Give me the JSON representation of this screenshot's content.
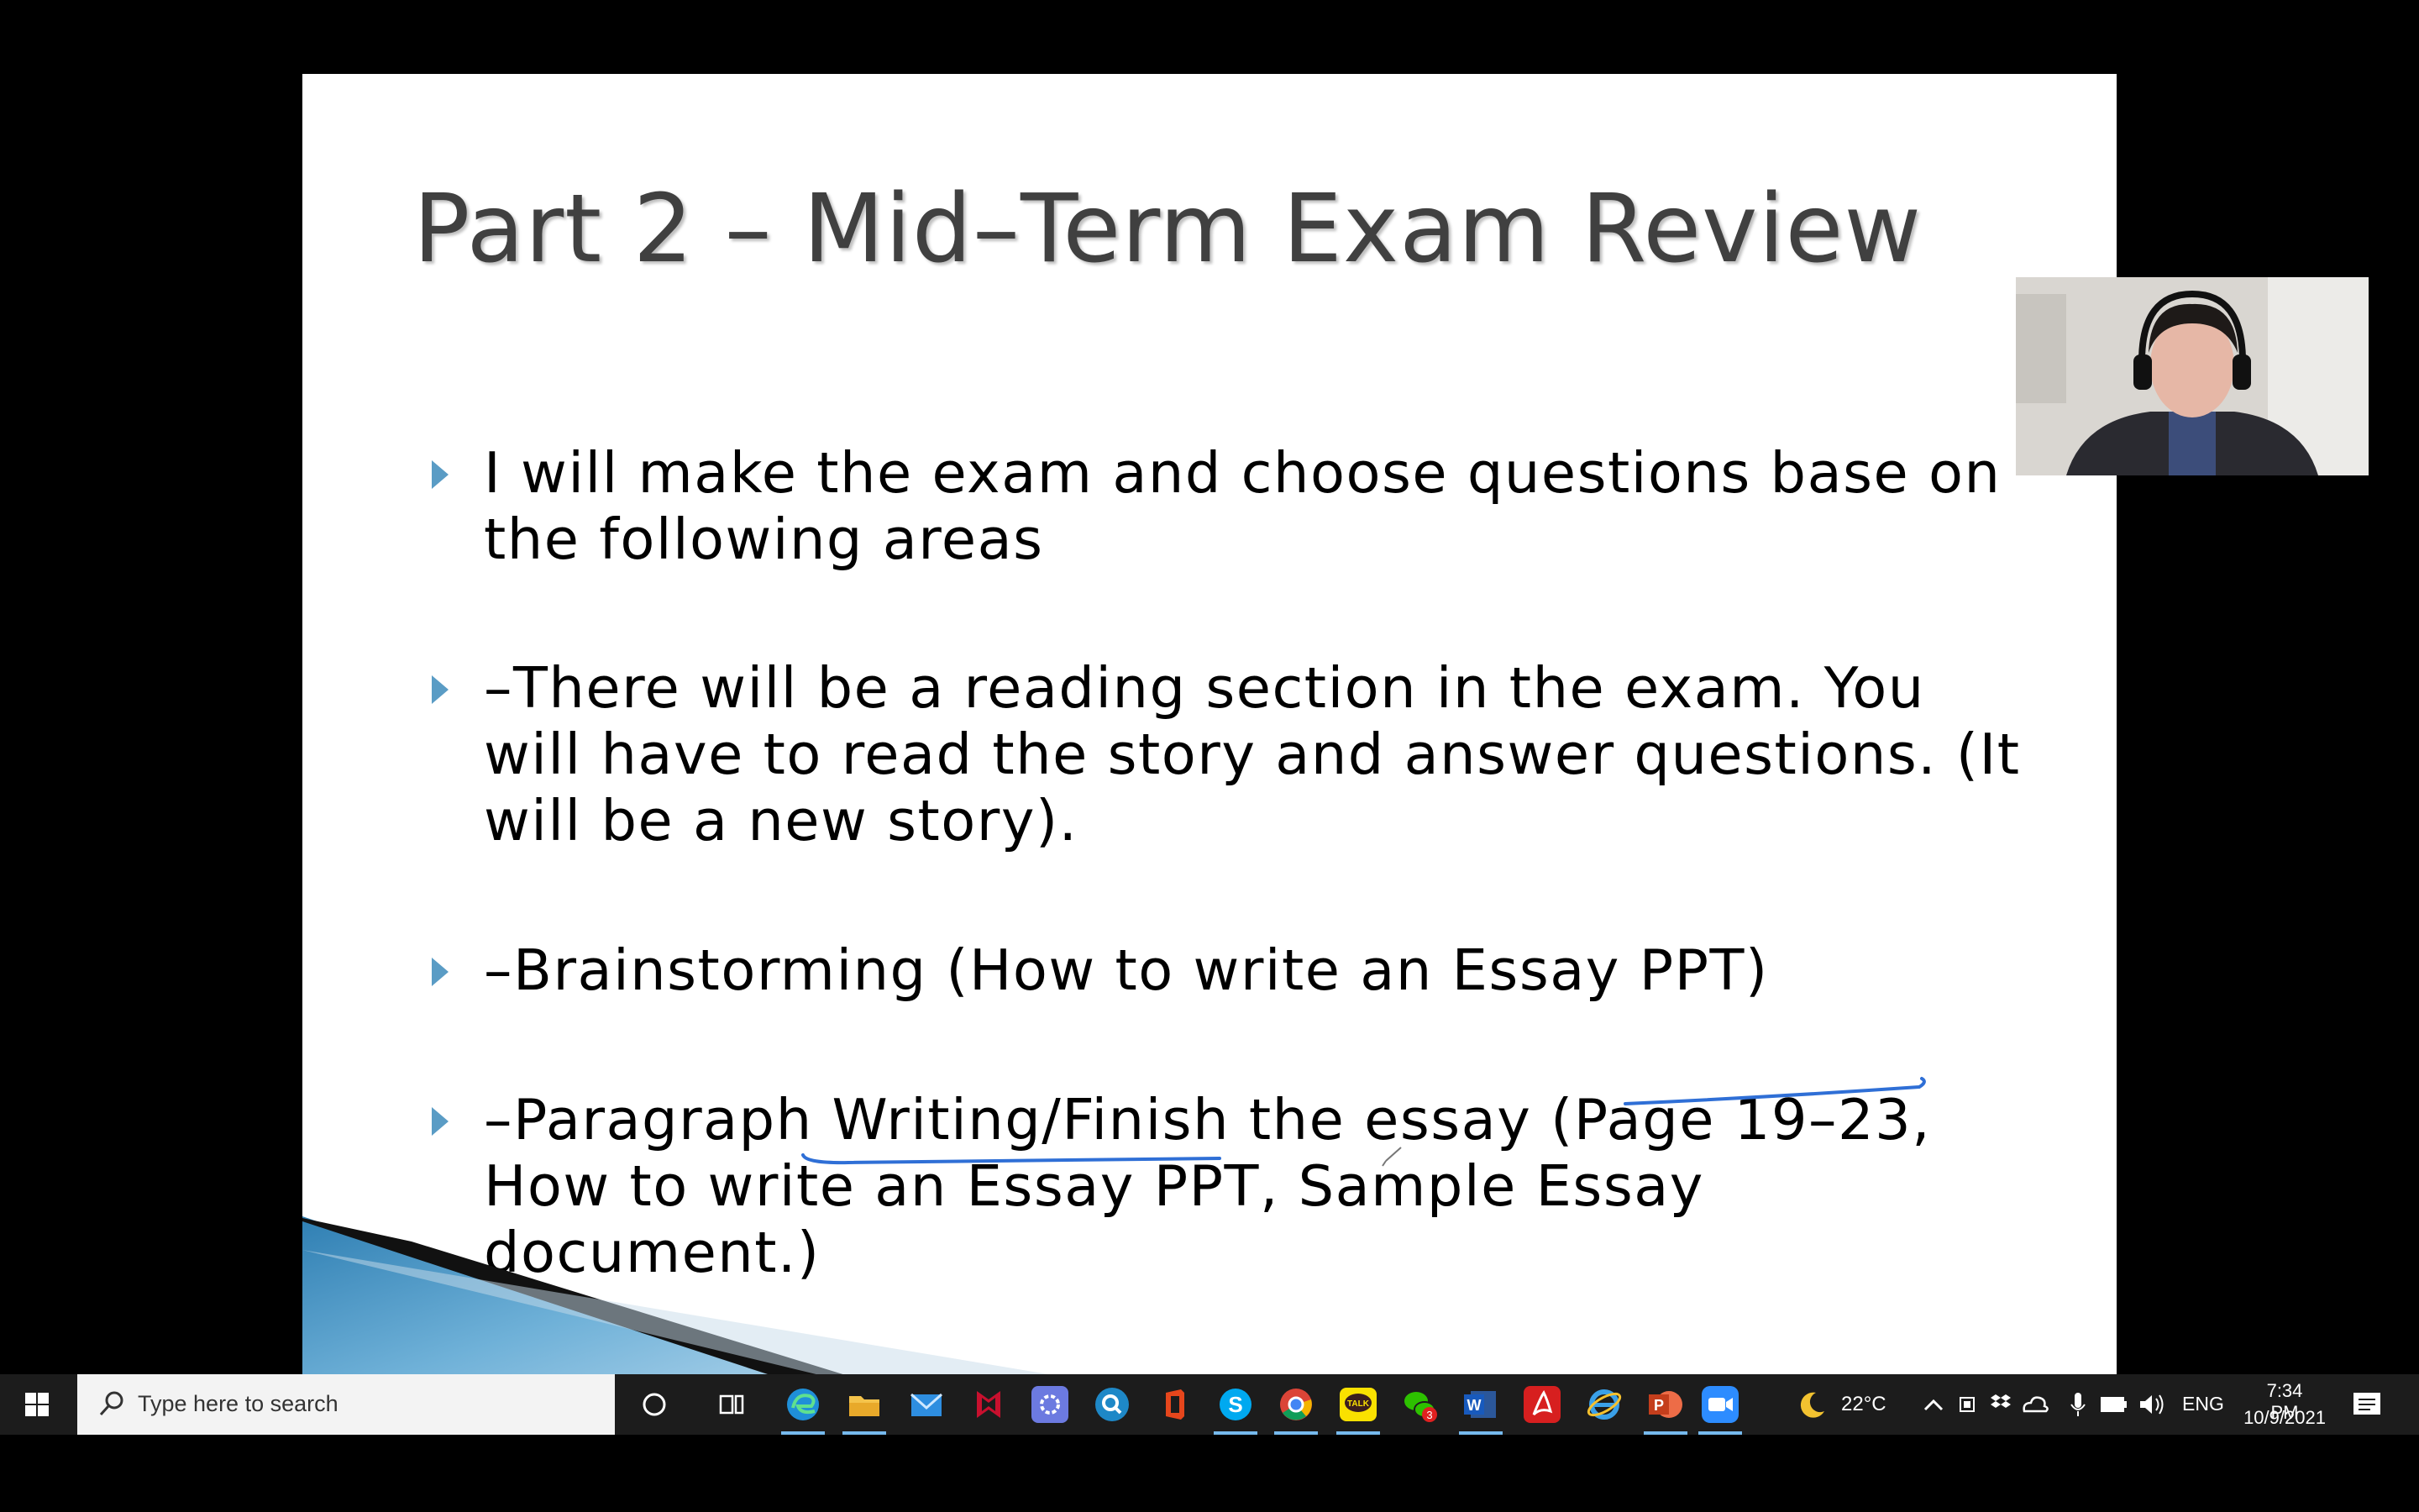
{
  "slide": {
    "title": "Part 2 – Mid–Term Exam Review",
    "bullets": [
      {
        "line1": "I will make the exam and choose questions base on",
        "line2": "the following areas",
        "line3": ""
      },
      {
        "line1": "–There will be a reading section in the exam. You",
        "line2": "will have to read the story and answer questions. (It",
        "line3": "will be a new story)."
      },
      {
        "line1": "–Brainstorming (How to write an Essay PPT)",
        "line2": "",
        "line3": ""
      },
      {
        "line1": "–Paragraph Writing/Finish the essay (Page 19–23,",
        "line2": "How to write an Essay PPT, Sample Essay",
        "line3": "document.)"
      }
    ],
    "accent_color": "#5a9cc5",
    "annotation_color": "#2f6fd6"
  },
  "webcam": {
    "icon": "presenter-video"
  },
  "taskbar": {
    "search_placeholder": "Type here to search",
    "pinned_icons": [
      "cortana-icon",
      "task-view-icon",
      "edge-icon",
      "file-explorer-icon",
      "mail-icon",
      "mcafee-icon",
      "settings-icon",
      "search-app-icon",
      "office-icon",
      "skype-icon",
      "chrome-icon",
      "kakaotalk-icon",
      "wechat-icon",
      "word-icon",
      "acrobat-icon",
      "internet-explorer-icon",
      "powerpoint-icon",
      "zoom-icon"
    ],
    "kakaotalk_label": "TALK",
    "wechat_badge": "3",
    "weather": "22°C",
    "language": "ENG",
    "time": "7:34 PM",
    "date": "10/9/2021"
  }
}
